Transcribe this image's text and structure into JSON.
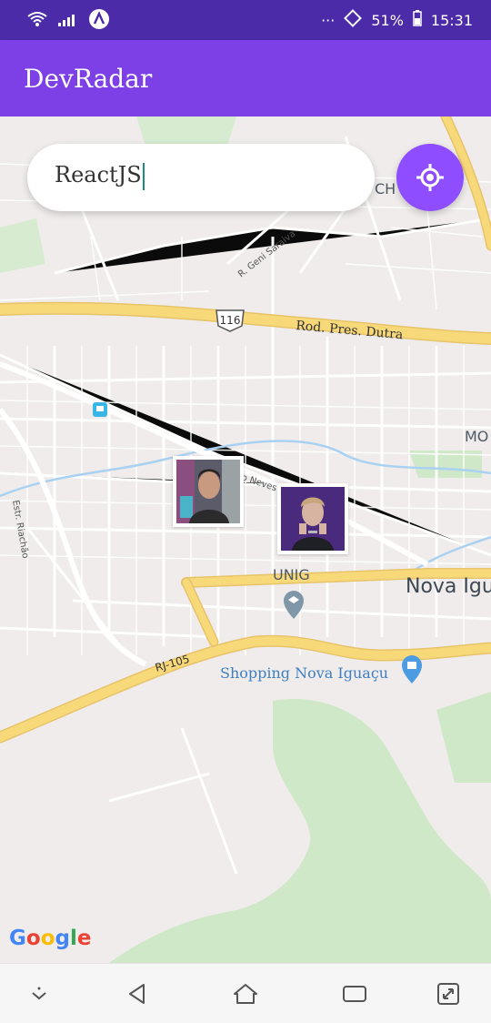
{
  "status_bar": {
    "battery": "51%",
    "time": "15:31"
  },
  "app": {
    "title": "DevRadar"
  },
  "search": {
    "value": "ReactJS"
  },
  "map": {
    "labels": {
      "rod_pres_dutra": "Rod. Pres. Dutra",
      "highway_116": "116",
      "r_geni_saraiva": "R. Geni Saraiva",
      "estr_riachao": "Estr. Riachão",
      "neves": "o Neves",
      "unig": "UNIG",
      "nova_iguacu": "Nova Igu",
      "rj105": "RJ-105",
      "shopping": "Shopping Nova Iguaçu",
      "mo": "MO",
      "ch": "CH"
    },
    "google": "Google"
  },
  "colors": {
    "status_bar": "#4b2ba8",
    "app_bar": "#7d40e7",
    "accent": "#8e4dff",
    "road_major": "#f8d97a"
  }
}
